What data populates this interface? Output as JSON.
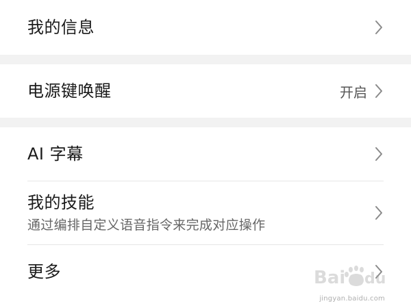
{
  "settings": {
    "my_info": {
      "title": "我的信息"
    },
    "power_key_wakeup": {
      "title": "电源键唤醒",
      "value": "开启"
    },
    "ai_subtitles": {
      "title": "AI 字幕"
    },
    "my_skills": {
      "title": "我的技能",
      "subtitle": "通过编排自定义语音指令来完成对应操作"
    },
    "more": {
      "title": "更多"
    }
  },
  "watermark": {
    "text": "jingyan.baidu.com"
  },
  "colors": {
    "background": "#ffffff",
    "section_gap": "#f2f2f2",
    "divider": "#e6e6e6",
    "chevron": "#8a8a8a"
  },
  "icons": {
    "row_arrow": "chevron-right-icon",
    "watermark_logo": "baidu-paw-logo-icon"
  }
}
